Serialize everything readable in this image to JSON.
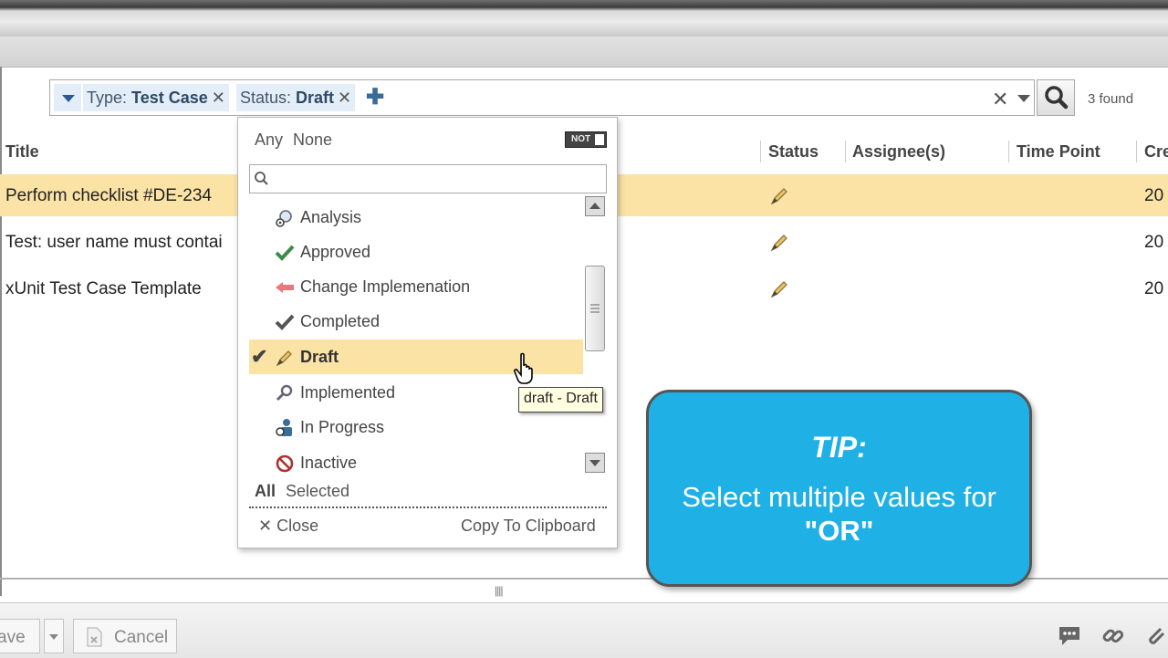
{
  "filter": {
    "type_label": "Type:",
    "type_value": "Test Case",
    "status_label": "Status:",
    "status_value": "Draft",
    "found": "3 found"
  },
  "table": {
    "columns": [
      "Title",
      "Status",
      "Assignee(s)",
      "Time Point",
      "Cre"
    ],
    "rows": [
      {
        "title": "Perform checklist #DE-234",
        "created": "20"
      },
      {
        "title": "Test: user name must contai",
        "created": "20"
      },
      {
        "title": "xUnit Test Case Template",
        "created": "20"
      }
    ]
  },
  "dropdown": {
    "any": "Any",
    "none": "None",
    "not_label": "NOT",
    "options": [
      "Analysis",
      "Approved",
      "Change Implemenation",
      "Completed",
      "Draft",
      "Implemented",
      "In Progress",
      "Inactive"
    ],
    "all": "All",
    "selected": "Selected",
    "close": "Close",
    "copy": "Copy To Clipboard"
  },
  "tooltip": "draft - Draft",
  "tip": {
    "heading": "TIP:",
    "line1": "Select multiple values for",
    "line2": "\"OR\""
  },
  "footer": {
    "save": "ave",
    "cancel": "Cancel"
  },
  "colors": {
    "selected_row": "#fbe3a6",
    "tip_bg": "#1fb0e6",
    "chip_bg": "#e3eef8"
  }
}
